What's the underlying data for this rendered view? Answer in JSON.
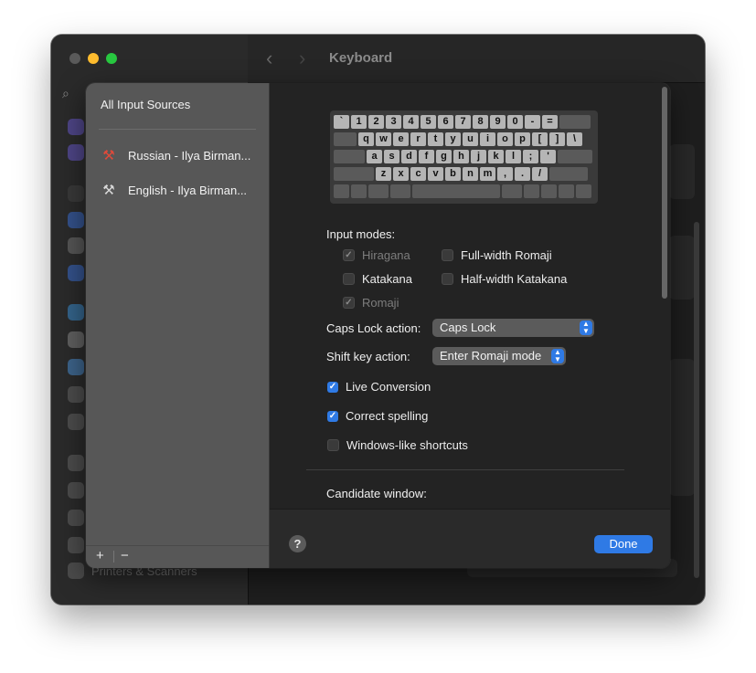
{
  "window": {
    "title": "Keyboard",
    "sidebar_bottom_item": "Printers & Scanners"
  },
  "sheet": {
    "source_list": {
      "header": "All Input Sources",
      "items": [
        {
          "label": "Russian - Ilya Birman...",
          "icon": "russian-keyboard-icon",
          "icon_color": "#e04a3a"
        },
        {
          "label": "English - Ilya Birman...",
          "icon": "english-keyboard-icon",
          "icon_color": "#d9d9d9"
        }
      ],
      "add_label": "+",
      "remove_label": "−"
    },
    "keyboard": {
      "rows": [
        [
          "`",
          "1",
          "2",
          "3",
          "4",
          "5",
          "6",
          "7",
          "8",
          "9",
          "0",
          "-",
          "="
        ],
        [
          "q",
          "w",
          "e",
          "r",
          "t",
          "y",
          "u",
          "i",
          "o",
          "p",
          "[",
          "]",
          "\\"
        ],
        [
          "a",
          "s",
          "d",
          "f",
          "g",
          "h",
          "j",
          "k",
          "l",
          ";",
          "'"
        ],
        [
          "z",
          "x",
          "c",
          "v",
          "b",
          "n",
          "m",
          ",",
          ".",
          "/"
        ]
      ]
    },
    "input_modes": {
      "label": "Input modes:",
      "options": [
        {
          "label": "Hiragana",
          "checked": true,
          "disabled": true
        },
        {
          "label": "Full-width Romaji",
          "checked": false,
          "disabled": false
        },
        {
          "label": "Katakana",
          "checked": false,
          "disabled": false
        },
        {
          "label": "Half-width Katakana",
          "checked": false,
          "disabled": false
        },
        {
          "label": "Romaji",
          "checked": true,
          "disabled": true
        }
      ]
    },
    "caps_lock": {
      "label": "Caps Lock action:",
      "value": "Caps Lock"
    },
    "shift_key": {
      "label": "Shift key action:",
      "value": "Enter Romaji mode"
    },
    "options": [
      {
        "label": "Live Conversion",
        "checked": true
      },
      {
        "label": "Correct spelling",
        "checked": true
      },
      {
        "label": "Windows-like shortcuts",
        "checked": false
      }
    ],
    "candidate_window": {
      "label": "Candidate window:"
    },
    "help_label": "?",
    "done_label": "Done"
  },
  "colors": {
    "accent": "#2f7ae5",
    "traffic_close": "#5a5a5a",
    "traffic_minimize": "#febc2e",
    "traffic_maximize": "#28c840"
  }
}
